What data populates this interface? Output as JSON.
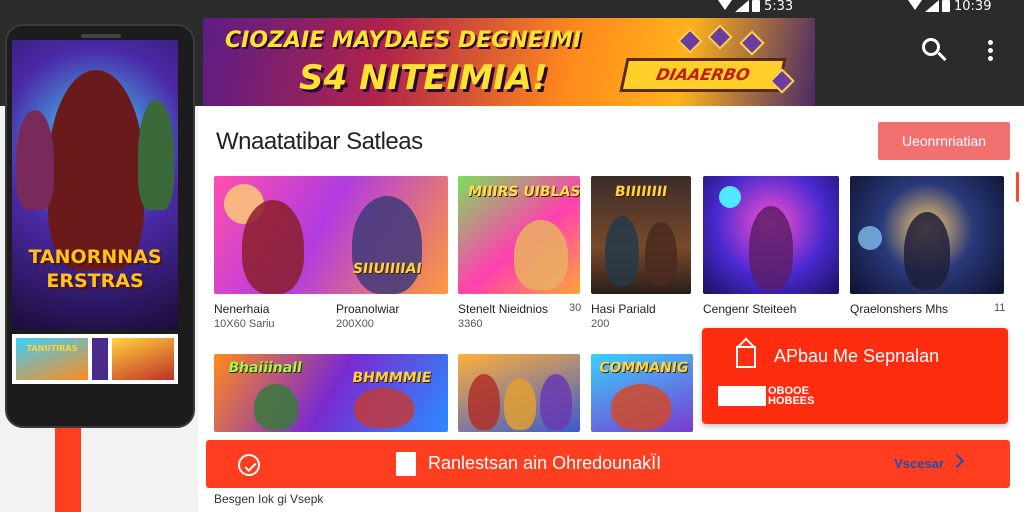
{
  "status_bar": {
    "left_time": "5:33",
    "right_time": "10:39"
  },
  "banner": {
    "headline_top": "CIOZAIE MAYDAES DEGNEIMI",
    "headline_big": "S4 NITEIMIA!",
    "tag": "DIAAERBO"
  },
  "section": {
    "title": "Wnaatatibar Satleas",
    "all_button": "Ueonrnriatian"
  },
  "games_row1": [
    {
      "name": "Nenerhaia",
      "sub": "10X60 Sariu",
      "thumb_title": ""
    },
    {
      "name": "Proanolwiar",
      "sub": "200X00",
      "thumb_title": "SIIUIIIIAI"
    },
    {
      "name": "Stenelt  Nieidnios",
      "sub": "3360",
      "thumb_title": "MIIIRS UIBLAS",
      "extra": "30"
    },
    {
      "name": "Hasi Pariald",
      "sub": "200",
      "thumb_title": "BIIIIIIII"
    },
    {
      "name": "Cengenr Steiteeh",
      "sub": "",
      "thumb_title": ""
    },
    {
      "name": "Qraelonshers Mhs",
      "sub": "",
      "thumb_title": "",
      "extra": "11"
    }
  ],
  "games_row2": [
    {
      "thumb_title": "Bhaiiinall"
    },
    {
      "thumb_title": "BHMMMIE"
    },
    {
      "thumb_title": ""
    },
    {
      "thumb_title": "COMMANIG"
    }
  ],
  "phone": {
    "title_line1": "TANORNNAS",
    "title_line2": "ERSTRAS",
    "strip_title": "TANUTIRAS"
  },
  "popup": {
    "text": "APbau Me Sepnalan",
    "mini_text": "OBOOE\nHOBEES"
  },
  "action_bar": {
    "label": "Ranlestsan ain OhredounakÏI",
    "right_label": "Vscesar"
  },
  "footer": {
    "text": "Besgen Iok  gi Vsepk"
  },
  "colors": {
    "accent": "#ff3d1f",
    "all_button": "#f27070",
    "top_bar": "#2b2b2b"
  }
}
